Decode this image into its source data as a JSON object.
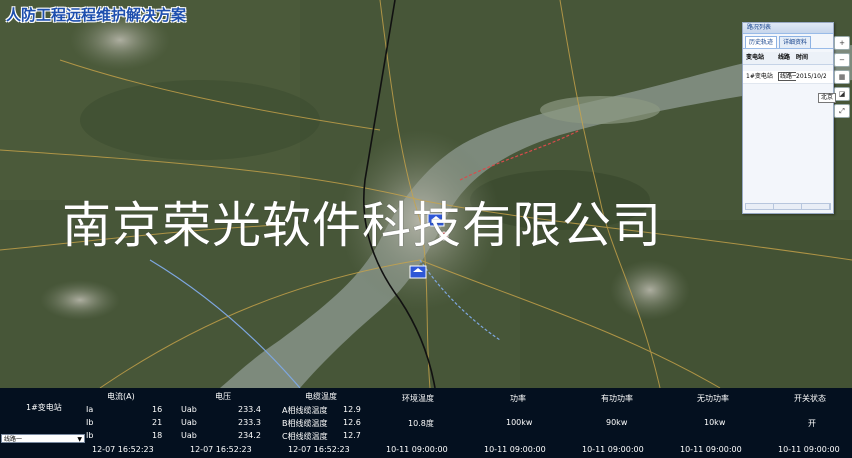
{
  "app": {
    "title": "人防工程远程维护解决方案"
  },
  "watermark": "南京荣光软件科技有限公司",
  "panel": {
    "title": "路况列表",
    "tabs": [
      "历史轨迹",
      "详细资料"
    ],
    "columns": [
      "变电站",
      "线路",
      "时间"
    ],
    "rows": [
      {
        "station": "1#变电站",
        "line": "线路一",
        "time": "2015/10/20"
      }
    ]
  },
  "map_tools": {
    "tag": "北京"
  },
  "stats": {
    "station_name": "1#变电站",
    "station_select": "线路一",
    "current_header": "电流(A)",
    "voltage_header": "电压",
    "cable_temp_header": "电缆温度",
    "env_temp_header": "环境温度",
    "power_header": "功率",
    "active_power_header": "有功功率",
    "reactive_power_header": "无功功率",
    "switch_header": "开关状态",
    "current_rows": [
      {
        "label": "Ia",
        "value": "16"
      },
      {
        "label": "Ib",
        "value": "21"
      },
      {
        "label": "Ib",
        "value": "18"
      }
    ],
    "voltage_rows": [
      {
        "label": "Uab",
        "value": "233.4"
      },
      {
        "label": "Uab",
        "value": "233.3"
      },
      {
        "label": "Uab",
        "value": "234.2"
      }
    ],
    "cable_rows": [
      {
        "label": "A相线缆温度",
        "value": "12.9"
      },
      {
        "label": "B相线缆温度",
        "value": "12.6"
      },
      {
        "label": "C相线缆温度",
        "value": "12.7"
      }
    ],
    "env_temp": "10.8度",
    "power": "100kw",
    "active_power": "90kw",
    "reactive_power": "10kw",
    "switch_state": "开",
    "current_time": "12-07 16:52:23",
    "voltage_time": "12-07 16:52:23",
    "cable_time": "12-07 16:52:23",
    "env_time": "10-11 09:00:00",
    "power_time": "10-11 09:00:00",
    "active_time": "10-11 09:00:00",
    "reactive_time": "10-11 09:00:00",
    "switch_time": "10-11 09:00:00"
  },
  "colors": {
    "bottom_bg": "#04101f",
    "river": "#7d8a7c",
    "title": "#1e4fae"
  }
}
